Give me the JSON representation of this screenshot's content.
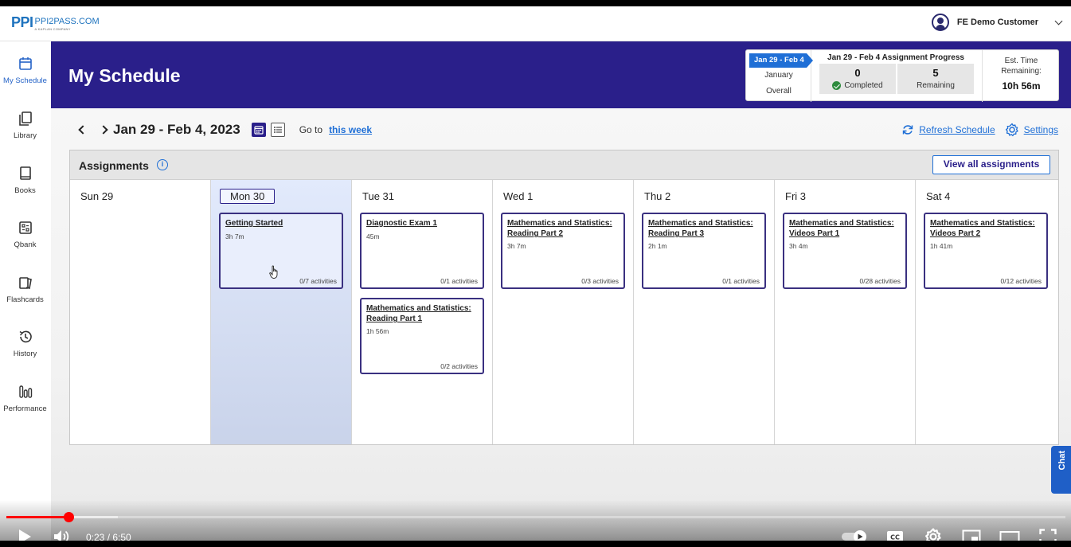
{
  "brand": {
    "logo_mark": "PPI",
    "logo_site": "PPI2PASS.COM",
    "logo_tagline": "A KAPLAN COMPANY"
  },
  "user": {
    "name": "FE Demo Customer"
  },
  "sidebar": {
    "items": [
      {
        "label": "My Schedule",
        "icon": "calendar-icon",
        "active": true
      },
      {
        "label": "Library",
        "icon": "library-icon"
      },
      {
        "label": "Books",
        "icon": "book-icon"
      },
      {
        "label": "Qbank",
        "icon": "qbank-icon"
      },
      {
        "label": "Flashcards",
        "icon": "flashcards-icon"
      },
      {
        "label": "History",
        "icon": "history-icon"
      },
      {
        "label": "Performance",
        "icon": "bar-chart-icon"
      }
    ]
  },
  "header": {
    "title": "My Schedule",
    "progress": {
      "period_selected": "Jan 29 - Feb 4",
      "period_options": [
        "January",
        "Overall"
      ],
      "title": "Jan 29 - Feb 4 Assignment Progress",
      "completed_value": "0",
      "completed_label": "Completed",
      "remaining_value": "5",
      "remaining_label": "Remaining",
      "time_label": "Est. Time Remaining:",
      "time_value": "10h 56m"
    }
  },
  "week": {
    "range": "Jan 29 - Feb 4, 2023",
    "goto_label": "Go to",
    "goto_link": "this week",
    "refresh_label": "Refresh Schedule",
    "settings_label": "Settings"
  },
  "assignments": {
    "title": "Assignments",
    "view_all": "View all assignments",
    "days": [
      {
        "label": "Sun 29",
        "today": false,
        "cards": []
      },
      {
        "label": "Mon 30",
        "today": true,
        "cards": [
          {
            "title": "Getting Started",
            "time": "3h 7m",
            "activities": "0/7 activities"
          }
        ]
      },
      {
        "label": "Tue 31",
        "today": false,
        "cards": [
          {
            "title": "Diagnostic Exam 1",
            "time": "45m",
            "activities": "0/1 activities"
          },
          {
            "title": "Mathematics and Statistics: Reading Part 1",
            "time": "1h 56m",
            "activities": "0/2 activities"
          }
        ]
      },
      {
        "label": "Wed 1",
        "today": false,
        "cards": [
          {
            "title": "Mathematics and Statistics: Reading Part 2",
            "time": "3h 7m",
            "activities": "0/3 activities"
          }
        ]
      },
      {
        "label": "Thu 2",
        "today": false,
        "cards": [
          {
            "title": "Mathematics and Statistics: Reading Part 3",
            "time": "2h 1m",
            "activities": "0/1 activities"
          }
        ]
      },
      {
        "label": "Fri 3",
        "today": false,
        "cards": [
          {
            "title": "Mathematics and Statistics: Videos Part 1",
            "time": "3h 4m",
            "activities": "0/28 activities"
          }
        ]
      },
      {
        "label": "Sat 4",
        "today": false,
        "cards": [
          {
            "title": "Mathematics and Statistics: Videos Part 2",
            "time": "1h 41m",
            "activities": "0/12 activities"
          }
        ]
      }
    ]
  },
  "chat": {
    "label": "Chat"
  },
  "player": {
    "current_time": "0:23",
    "duration": "6:50",
    "time_display": "0:23 / 6:50",
    "played_fraction": 0.0586,
    "buffered_fraction": 0.105,
    "accent": "#ff0000"
  },
  "colors": {
    "header_bg": "#2a1f8a",
    "link": "#1f6fd6",
    "brand_blue": "#1e73be"
  }
}
